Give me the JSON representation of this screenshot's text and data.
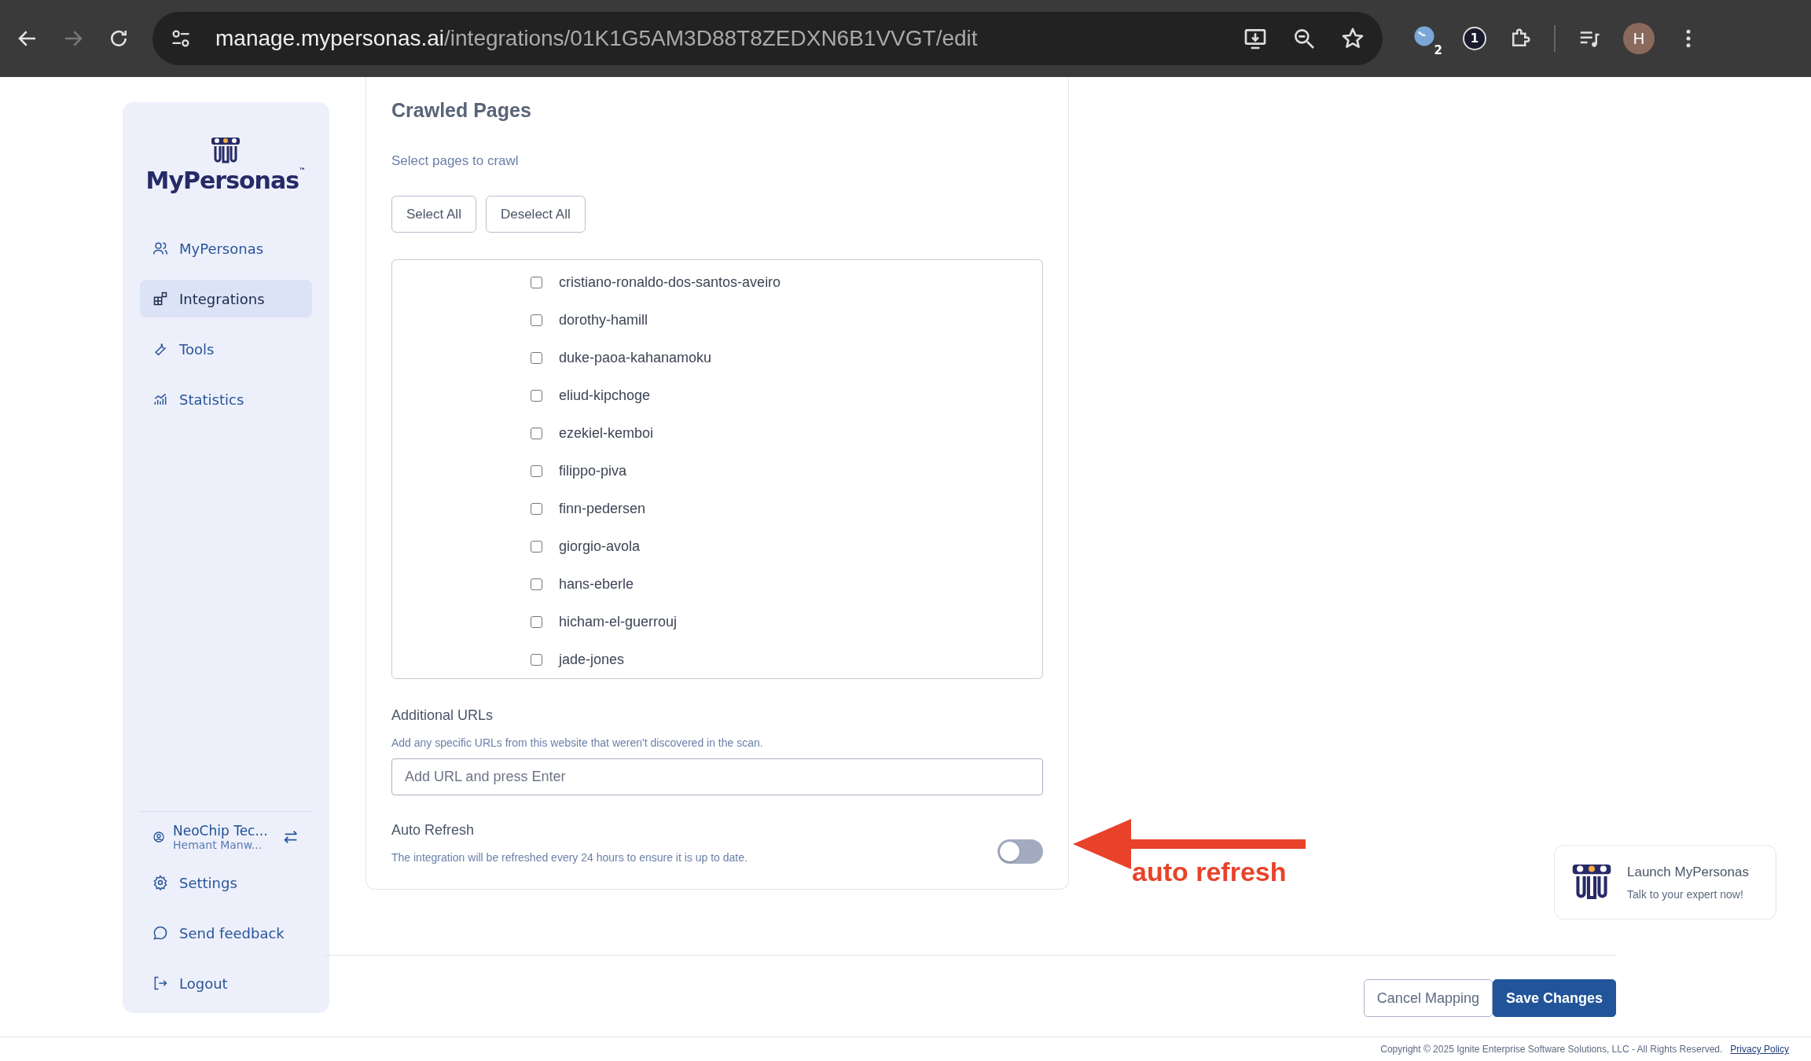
{
  "browser": {
    "url_host": "manage.mypersonas.ai",
    "url_path": "/integrations/01K1G5AM3D88T8ZEDXN6B1VVGT/edit",
    "extension_badge": "2",
    "extension_count": "1",
    "profile_initial": "H"
  },
  "sidebar": {
    "logo": "MyPersonas",
    "logo_mark": "™",
    "items": [
      {
        "label": "MyPersonas",
        "kind": "users",
        "selected": false
      },
      {
        "label": "Integrations",
        "kind": "grid",
        "selected": true
      },
      {
        "label": "Tools",
        "kind": "wrench",
        "selected": false
      },
      {
        "label": "Statistics",
        "kind": "chart",
        "selected": false
      }
    ],
    "account": {
      "name": "NeoChip Tec...",
      "user": "Hemant Manw..."
    },
    "bottom_items": [
      {
        "label": "Settings",
        "kind": "gear"
      },
      {
        "label": "Send feedback",
        "kind": "chat"
      },
      {
        "label": "Logout",
        "kind": "logout"
      }
    ]
  },
  "crawled_pages": {
    "title": "Crawled Pages",
    "subtitle": "Select pages to crawl",
    "buttons": [
      "Select All",
      "Deselect All"
    ],
    "pages": [
      {
        "label": "cristiano-ronaldo-dos-santos-aveiro",
        "checked": false
      },
      {
        "label": "dorothy-hamill",
        "checked": false
      },
      {
        "label": "duke-paoa-kahanamoku",
        "checked": false
      },
      {
        "label": "eliud-kipchoge",
        "checked": false
      },
      {
        "label": "ezekiel-kemboi",
        "checked": false
      },
      {
        "label": "filippo-piva",
        "checked": false
      },
      {
        "label": "finn-pedersen",
        "checked": false
      },
      {
        "label": "giorgio-avola",
        "checked": false
      },
      {
        "label": "hans-eberle",
        "checked": false
      },
      {
        "label": "hicham-el-guerrouj",
        "checked": false
      },
      {
        "label": "jade-jones",
        "checked": false
      }
    ]
  },
  "additional_urls": {
    "label": "Additional URLs",
    "help": "Add any specific URLs from this website that weren't discovered in the scan.",
    "placeholder": "Add URL and press Enter"
  },
  "auto_refresh": {
    "label": "Auto Refresh",
    "description": "The integration will be refreshed every 24 hours to ensure it is up to date.",
    "on": false
  },
  "annotation": {
    "label": "auto refresh"
  },
  "footer_buttons": [
    {
      "label": "Cancel Mapping",
      "kind": "secondary"
    },
    {
      "label": "Save Changes",
      "kind": "primary"
    }
  ],
  "launch_widget": {
    "title": "Launch MyPersonas",
    "subtitle": "Talk to your expert now!"
  },
  "copyright": {
    "text": "Copyright © 2025 Ignite Enterprise Software Solutions, LLC - All Rights Reserved.",
    "link": "Privacy Policy"
  }
}
